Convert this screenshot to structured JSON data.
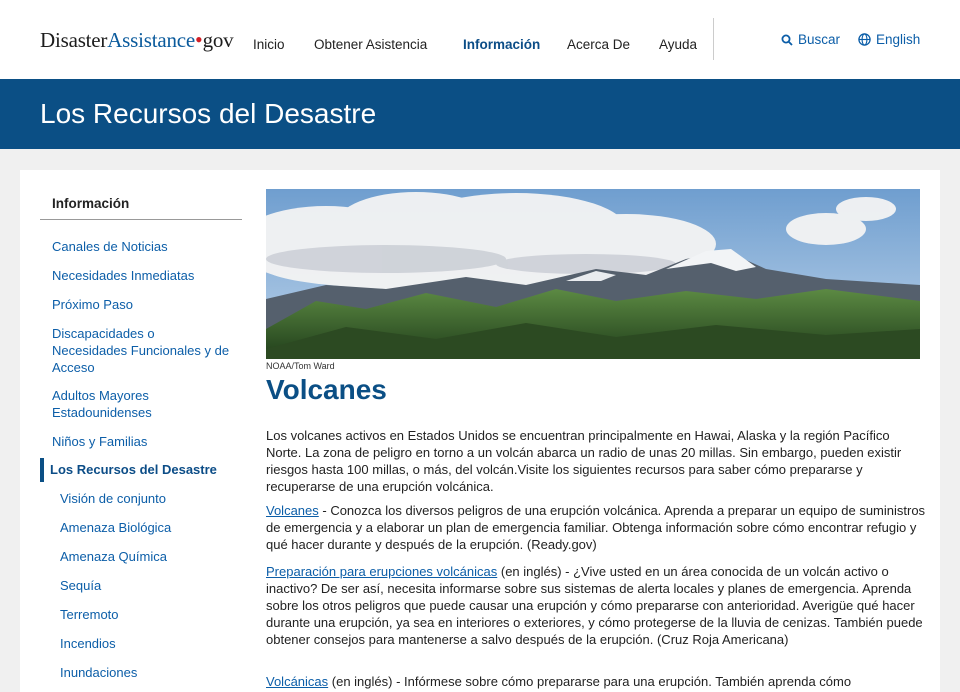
{
  "header": {
    "logo": {
      "part1": "Disaster",
      "part2": "Assistance",
      "dot": "•",
      "part3": "gov"
    },
    "nav": [
      "Inicio",
      "Obtener Asistencia",
      "Información",
      "Acerca De",
      "Ayuda"
    ],
    "search_label": "Buscar",
    "language_label": "English"
  },
  "banner": {
    "title": "Los Recursos del Desastre"
  },
  "sidebar": {
    "title": "Información",
    "links": [
      "Canales de Noticias",
      "Necesidades Inmediatas",
      "Próximo Paso",
      "Discapacidades o Necesidades Funcionales y de Acceso",
      "Adultos Mayores Estadounidenses",
      "Niños y Familias",
      "Los Recursos del Desastre"
    ],
    "sub_links": [
      "Visión de conjunto",
      "Amenaza Biológica",
      "Amenaza Química",
      "Sequía",
      "Terremoto",
      "Incendios",
      "Inundaciones"
    ]
  },
  "main": {
    "photo_credit": "NOAA/Tom Ward",
    "title": "Volcanes",
    "intro": "Los volcanes activos en Estados Unidos se encuentran principalmente en Hawai, Alaska y la región Pacífico Norte. La zona de peligro en torno a un volcán abarca un radio de unas 20 millas. Sin embargo, pueden existir riesgos hasta 100 millas, o más, del volcán.Visite los siguientes recursos para saber cómo prepararse y recuperarse de una erupción volcánica.",
    "resources": [
      {
        "link": "Volcanes",
        "text": " - Conozca los diversos peligros de una erupción volcánica. Aprenda a preparar un equipo de suministros de emergencia y a elaborar un plan de emergencia familiar. Obtenga información sobre cómo encontrar refugio y qué hacer durante y después de la erupción. (Ready.gov)"
      },
      {
        "link": "Preparación para erupciones volcánicas",
        "text": " (en inglés) - ¿Vive usted en un área conocida de un volcán activo o inactivo? De ser así, necesita informarse sobre sus sistemas de alerta locales y planes de emergencia. Aprenda sobre los otros peligros que puede causar una erupción y cómo prepararse con anterioridad. Averigüe qué hacer durante una erupción, ya sea en interiores o exteriores, y cómo protegerse de la lluvia de cenizas. También puede obtener consejos para mantenerse a salvo después de la erupción. (Cruz Roja Americana)"
      },
      {
        "link": "Volcánicas",
        "text": " (en inglés) - Infórmese sobre cómo prepararse para una erupción. También aprenda cómo"
      }
    ]
  }
}
